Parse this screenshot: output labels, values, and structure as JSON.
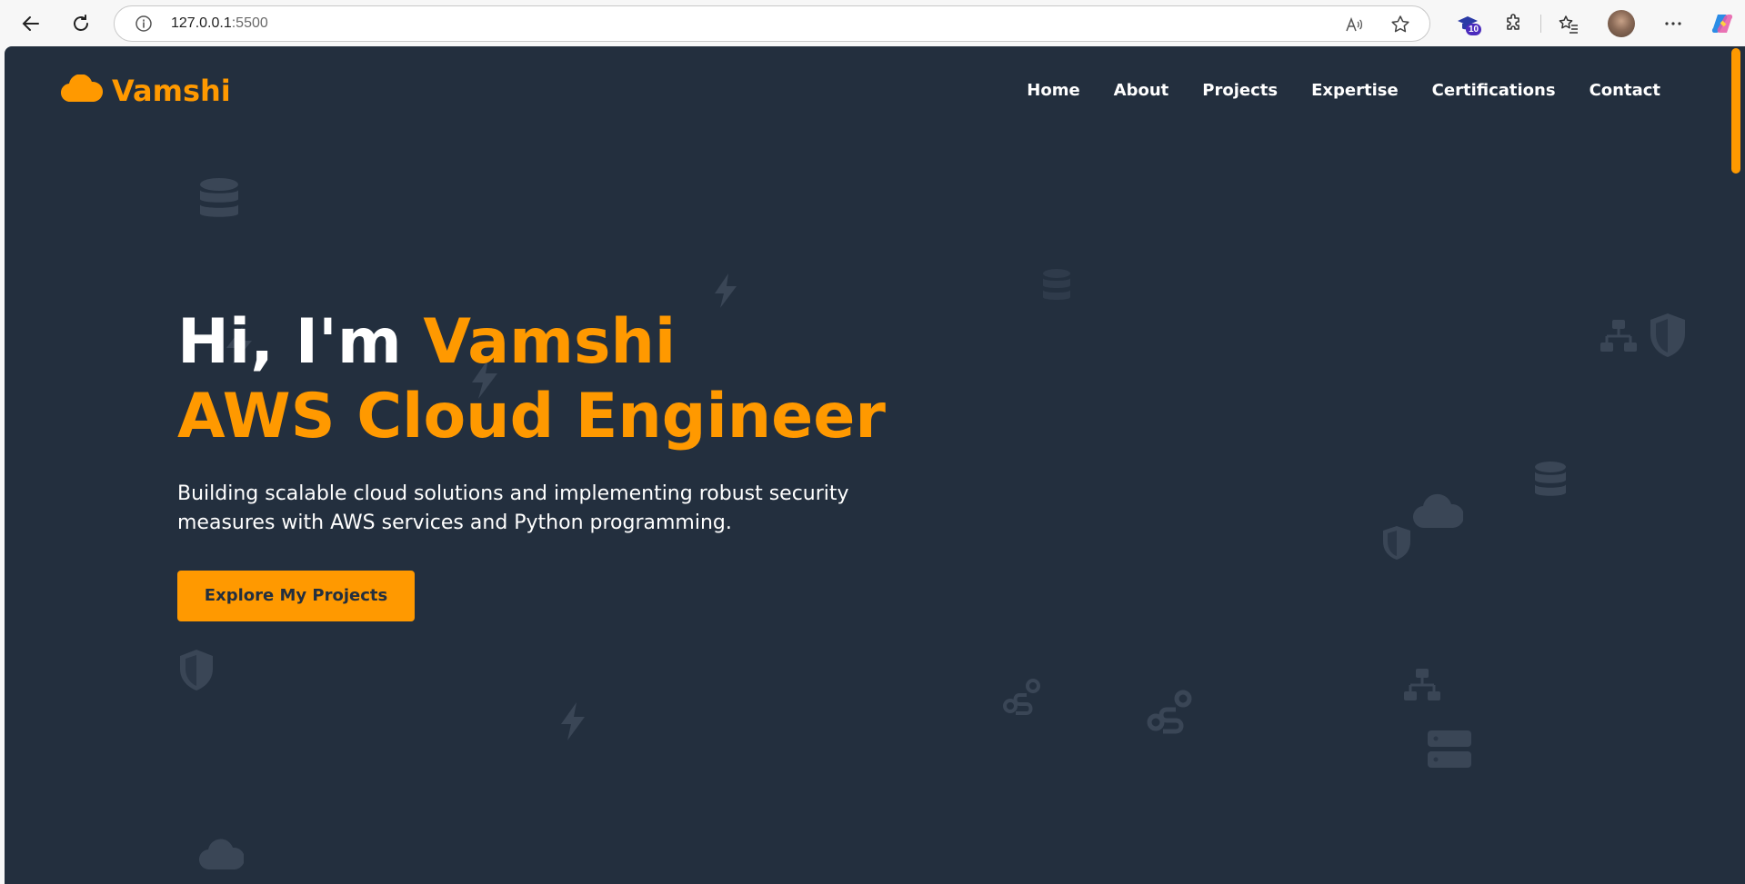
{
  "browser": {
    "url_host": "127.0.0.1",
    "url_port": ":5500",
    "extension_badge": "10"
  },
  "site": {
    "logo_text": "Vamshi",
    "nav": [
      "Home",
      "About",
      "Projects",
      "Expertise",
      "Certifications",
      "Contact"
    ],
    "hero": {
      "greeting": "Hi, I'm ",
      "name": "Vamshi",
      "role": "AWS Cloud Engineer",
      "description": "Building scalable cloud solutions and implementing robust security measures with AWS services and Python programming.",
      "cta": "Explore My Projects"
    }
  },
  "colors": {
    "page_bg": "#232f3e",
    "accent": "#ff9900",
    "text": "#ffffff",
    "deco": "#3a4656"
  }
}
